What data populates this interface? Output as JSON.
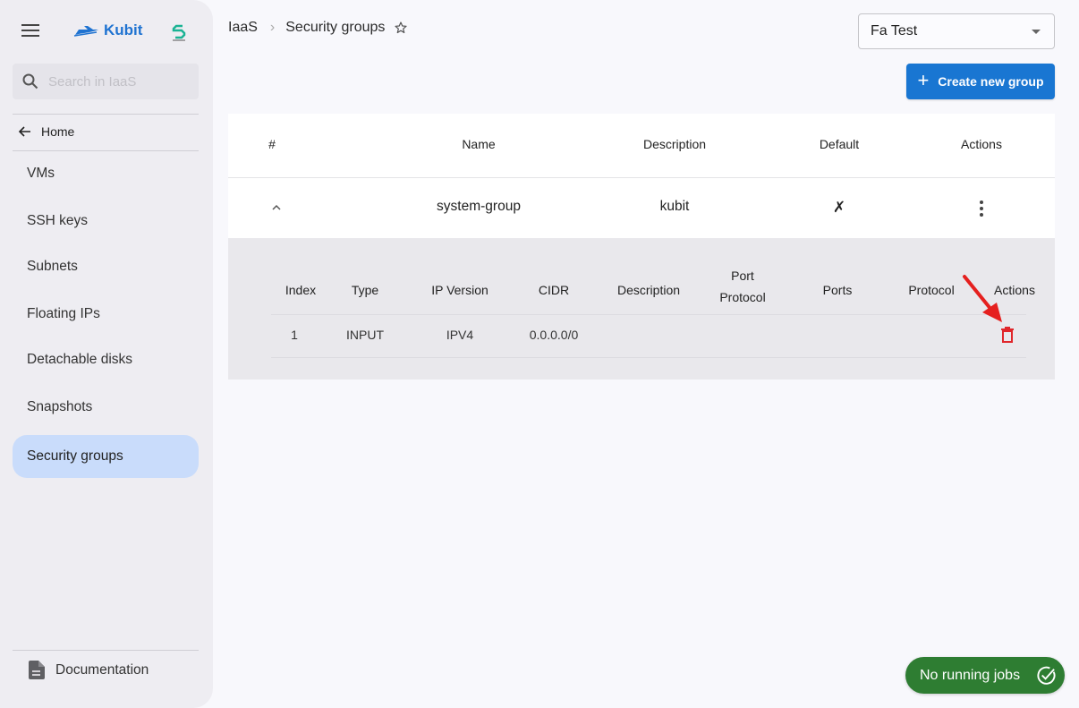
{
  "app": {
    "brand": "Kubit",
    "brand_color": "#1f73d1"
  },
  "sidebar": {
    "search_placeholder": "Search in IaaS",
    "search_value": "",
    "home_label": "Home",
    "items": [
      {
        "label": "VMs",
        "active": false
      },
      {
        "label": "SSH keys",
        "active": false
      },
      {
        "label": "Subnets",
        "active": false
      },
      {
        "label": "Floating IPs",
        "active": false
      },
      {
        "label": "Detachable disks",
        "active": false
      },
      {
        "label": "Snapshots",
        "active": false
      },
      {
        "label": "Security groups",
        "active": true
      }
    ],
    "documentation_label": "Documentation"
  },
  "breadcrumb": {
    "root": "IaaS",
    "current": "Security groups"
  },
  "project_select": {
    "value": "Fa Test"
  },
  "toolbar": {
    "create_label": "Create new group",
    "create_color": "#1976d2"
  },
  "table": {
    "columns": [
      "#",
      "Name",
      "Description",
      "Default",
      "Actions"
    ],
    "rows": [
      {
        "name": "system-group",
        "description": "kubit",
        "default": "✗",
        "expanded": true
      }
    ]
  },
  "rules_table": {
    "columns": [
      "Index",
      "Type",
      "IP Version",
      "CIDR",
      "Description",
      "Port Protocol",
      "Ports",
      "Protocol",
      "Actions"
    ],
    "port_protocol_line1": "Port",
    "port_protocol_line2": "Protocol",
    "rows": [
      {
        "index": "1",
        "type": "INPUT",
        "ip_version": "IPV4",
        "cidr": "0.0.0.0/0",
        "description": "",
        "port_protocol": "",
        "ports": "",
        "protocol": ""
      }
    ],
    "delete_color": "#e0262b"
  },
  "status": {
    "jobs_label": "No running jobs",
    "jobs_color": "#2e7d32"
  },
  "annotation": {
    "arrow_color": "#e5201f"
  }
}
